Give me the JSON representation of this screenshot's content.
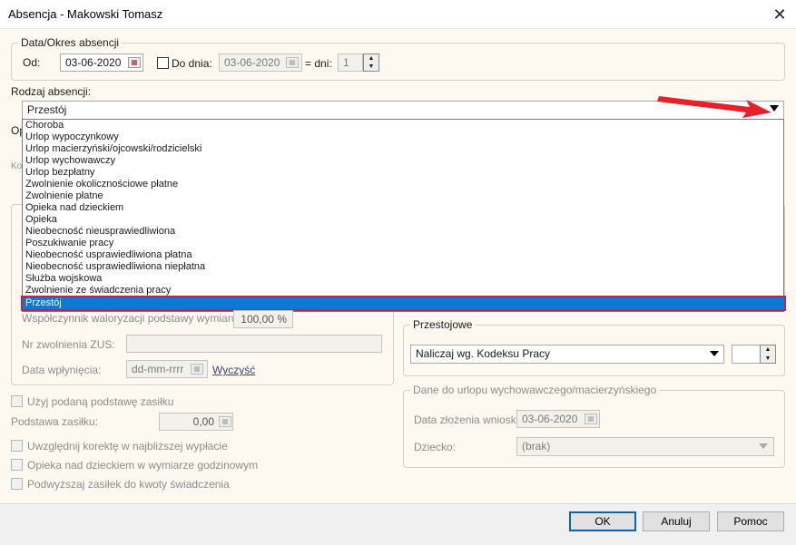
{
  "window": {
    "title": "Absencja - Makowski Tomasz",
    "close_glyph": "✕"
  },
  "period": {
    "legend": "Data/Okres absencji",
    "from_label": "Od:",
    "from_value": "03-06-2020",
    "to_checkbox_label": "Do dnia:",
    "to_value": "03-06-2020",
    "days_label": "= dni:",
    "days_value": "1"
  },
  "absence_type": {
    "label": "Rodzaj absencji:",
    "selected": "Przestój",
    "options": [
      "Choroba",
      "Urlop wypoczynkowy",
      "Urlop macierzyński/ojcowski/rodzicielski",
      "Urlop wychowawczy",
      "Urlop bezpłatny",
      "Zwolnienie okolicznościowe płatne",
      "Zwolnienie płatne",
      "Opieka nad dzieckiem",
      "Opieka",
      "Nieobecność nieusprawiedliwiona",
      "Poszukiwanie pracy",
      "Nieobecność usprawiedliwiona płatna",
      "Nieobecność usprawiedliwiona niepłatna",
      "Służba wojskowa",
      "Zwolnienie ze świadczenia pracy",
      "Przestój"
    ]
  },
  "hidden_label_fragments": {
    "op": "Op",
    "ko": "Ko"
  },
  "left_panel": {
    "valorization_label": "Współczynnik waloryzacji podstawy wymiaru:",
    "valorization_value": "100,00 %",
    "zus_label": "Nr zwolnienia ZUS:",
    "zus_value": "",
    "inflow_label": "Data wpłynięcia:",
    "inflow_placeholder": "dd-mm-rrrr",
    "clear_link": "Wyczyść",
    "use_base_label": "Użyj podaną podstawę zasiłku",
    "base_label": "Podstawa zasiłku:",
    "base_value": "0,00",
    "correction_label": "Uwzględnij korektę w najbliższej wypłacie",
    "care_label": "Opieka nad dzieckiem w wymiarze godzinowym",
    "raise_label": "Podwyższaj zasiłek do kwoty świadczenia"
  },
  "downtime": {
    "legend": "Przestojowe",
    "select_value": "Naliczaj wg. Kodeksu Pracy",
    "spin_value": ""
  },
  "parental": {
    "legend": "Dane do urlopu wychowawczego/macierzyńskiego",
    "request_date_label": "Data złożenia wniosku:",
    "request_date_value": "03-06-2020",
    "child_label": "Dziecko:",
    "child_value": "(brak)"
  },
  "buttons": {
    "ok": "OK",
    "cancel": "Anuluj",
    "help": "Pomoc"
  },
  "colors": {
    "selection": "#0f78d4",
    "highlight_outline": "#d81b3c",
    "arrow": "#e8202a"
  }
}
